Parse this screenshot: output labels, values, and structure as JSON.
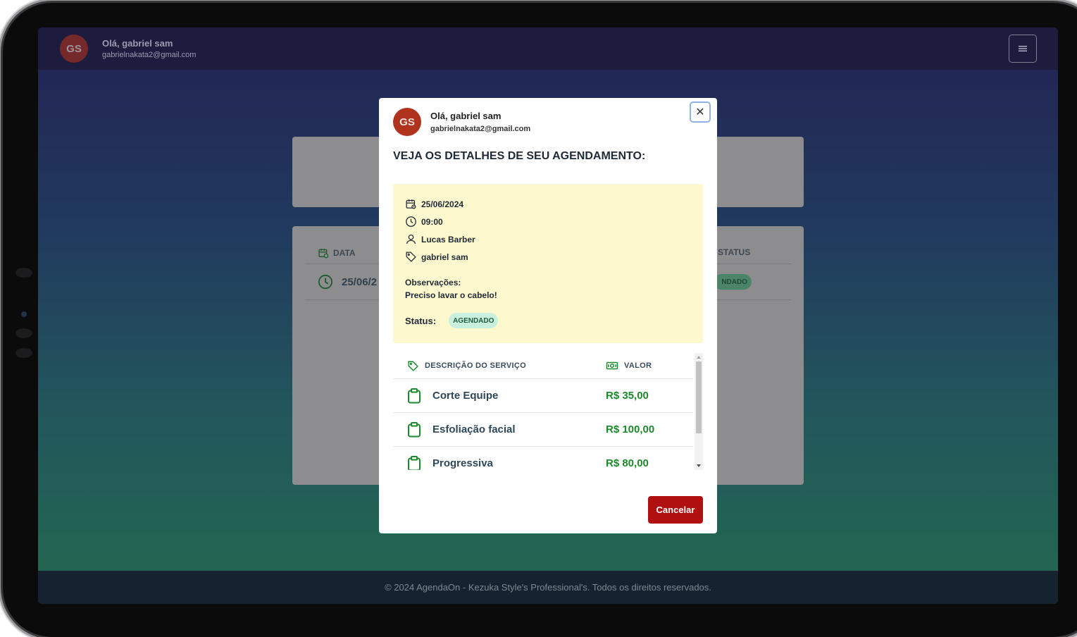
{
  "user": {
    "initials": "GS",
    "greeting": "Olá,  gabriel sam",
    "email": "gabrielnakata2@gmail.com"
  },
  "header": {
    "menu_icon": "hamburger-icon"
  },
  "background_table": {
    "col_date": "DATA",
    "col_status": "STATUS",
    "row_date": "25/06/2",
    "row_status": "NDADO"
  },
  "modal": {
    "close_label": "✕",
    "title": "VEJA OS DETALHES DE SEU AGENDAMENTO:",
    "details": {
      "date": "25/06/2024",
      "time": "09:00",
      "professional": "Lucas Barber",
      "client": "gabriel sam",
      "observations_label": "Observações:",
      "observations_text": "Preciso lavar o cabelo!",
      "status_label": "Status:",
      "status_value": "AGENDADO"
    },
    "services": {
      "col_description": "DESCRIÇÃO DO SERVIÇO",
      "col_value": "VALOR",
      "rows": [
        {
          "name": "Corte Equipe",
          "price": "R$ 35,00"
        },
        {
          "name": "Esfoliação facial",
          "price": "R$ 100,00"
        },
        {
          "name": "Progressiva",
          "price": "R$ 80,00"
        }
      ]
    },
    "cancel_label": "Cancelar"
  },
  "footer": {
    "text": "© 2024 AgendaOn - Kezuka Style's Professional's. Todos os direitos reservados."
  },
  "colors": {
    "avatar": "#b0331e",
    "details_bg": "#fef8cf",
    "badge_bg": "#c9f0dc",
    "price_green": "#1c8a2b",
    "cancel_red": "#b01010",
    "icon_green": "#1c8a2b"
  }
}
